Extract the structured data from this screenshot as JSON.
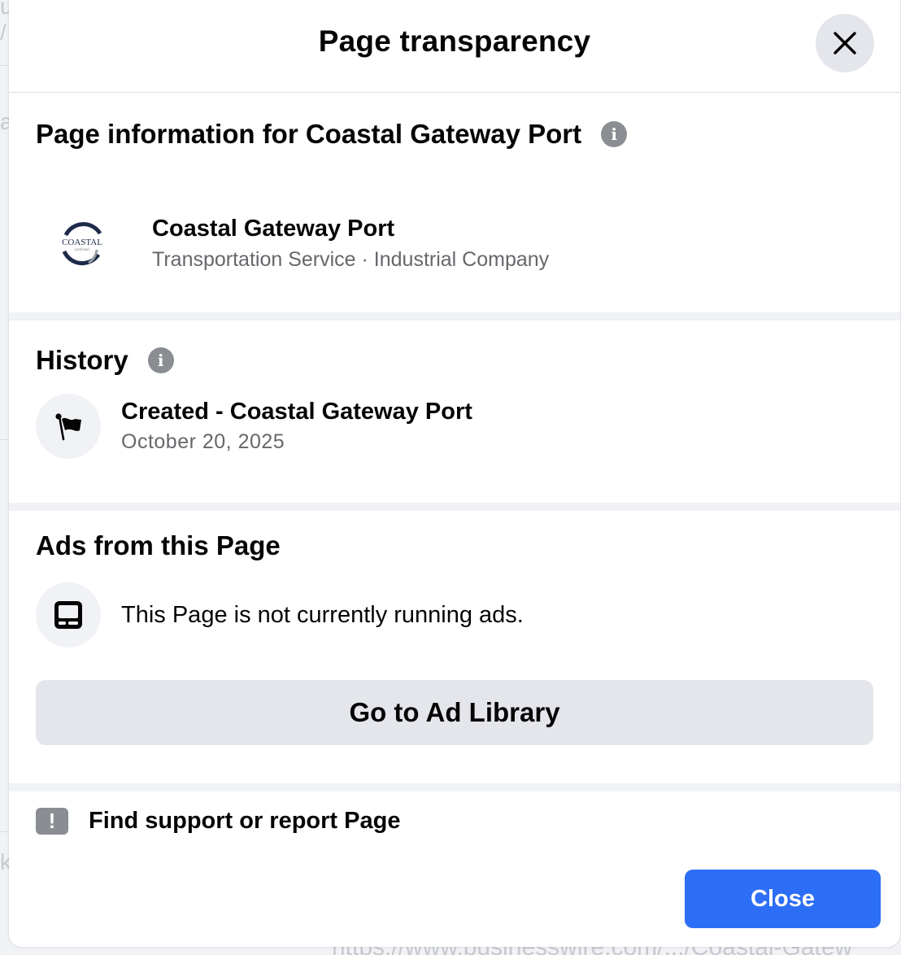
{
  "modal": {
    "title": "Page transparency",
    "close_button_label": "Close"
  },
  "page_info": {
    "heading": "Page information for Coastal Gateway Port",
    "page_name": "Coastal Gateway Port",
    "category": "Transportation Service · Industrial Company",
    "logo_text": "COASTAL",
    "logo_subtext": "GATEWAY"
  },
  "history": {
    "heading": "History",
    "items": [
      {
        "title": "Created - Coastal Gateway Port",
        "date": "October 20, 2025"
      }
    ]
  },
  "ads": {
    "heading": "Ads from this Page",
    "status": "This Page is not currently running ads.",
    "library_button": "Go to Ad Library"
  },
  "support": {
    "label": "Find support or report Page"
  },
  "background": {
    "url_fragment": "https://www.businesswire.com/.../Coastal-Gatew"
  },
  "colors": {
    "primary": "#2d6ef6",
    "secondary_button": "#e4e6eb",
    "muted_text": "#65676b",
    "icon_gray": "#8a8d91"
  },
  "icons": {
    "close": "close-icon",
    "info": "info-icon",
    "flag": "flag-icon",
    "ads": "ads-icon",
    "alert": "alert-icon"
  }
}
